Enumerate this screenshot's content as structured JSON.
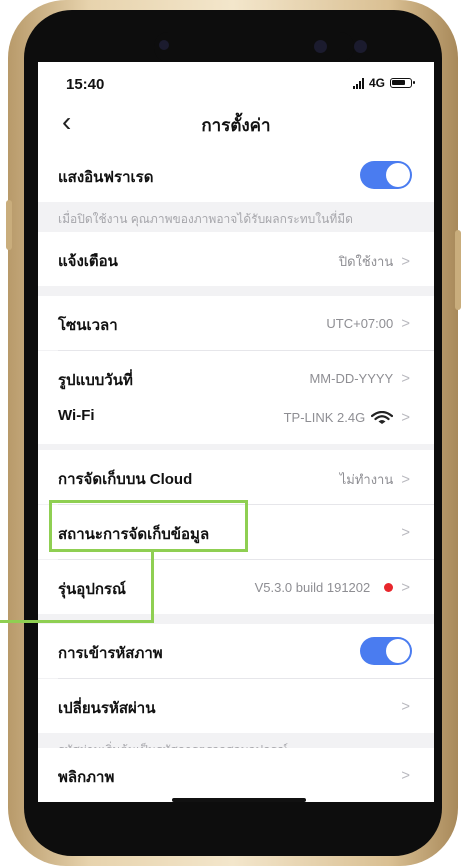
{
  "status_bar": {
    "time": "15:40",
    "network": "4G"
  },
  "header": {
    "title": "การตั้งค่า",
    "back_icon": "chevron-left-icon"
  },
  "settings": {
    "infrared": {
      "label": "แสงอินฟราเรด",
      "enabled": true,
      "hint": "เมื่อปิดใช้งาน คุณภาพของภาพอาจได้รับผลกระทบในที่มืด"
    },
    "alert": {
      "label": "แจ้งเตือน",
      "value": "ปิดใช้งาน"
    },
    "timezone": {
      "label": "โซนเวลา",
      "value": "UTC+07:00"
    },
    "date_format": {
      "label": "รูปแบบวันที่",
      "value": "MM-DD-YYYY"
    },
    "wifi": {
      "label": "Wi-Fi",
      "value": "TP-LINK 2.4G"
    },
    "cloud": {
      "label": "การจัดเก็บบน Cloud",
      "value": "ไม่ทำงาน"
    },
    "storage_status": {
      "label": "สถานะการจัดเก็บข้อมูล"
    },
    "device_model": {
      "label": "รุ่นอุปกรณ์",
      "value": "V5.3.0 build 191202"
    },
    "image_encryption": {
      "label": "การเข้ารหัสภาพ",
      "enabled": true
    },
    "change_password": {
      "label": "เปลี่ยนรหัสผ่าน",
      "hint": "รหัสผ่านเริ่มต้นเป็นรหัสการตรวจสอบอุปกรณ์"
    },
    "flip_image": {
      "label": "พลิกภาพ"
    }
  },
  "colors": {
    "accent": "#4a7cf0",
    "highlight": "#8fcf52",
    "alert_dot": "#e8262c"
  }
}
